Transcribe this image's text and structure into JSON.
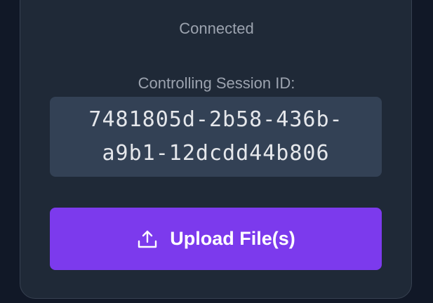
{
  "status": {
    "text": "Connected"
  },
  "session": {
    "label": "Controlling Session ID:",
    "id": "7481805d-2b58-436b-a9b1-12dcdd44b806"
  },
  "upload": {
    "label": "Upload File(s)",
    "icon": "upload-icon"
  },
  "colors": {
    "background": "#111827",
    "card": "#1f2937",
    "session_box": "#334155",
    "accent": "#7c3aed",
    "muted_text": "#9ca3af"
  }
}
